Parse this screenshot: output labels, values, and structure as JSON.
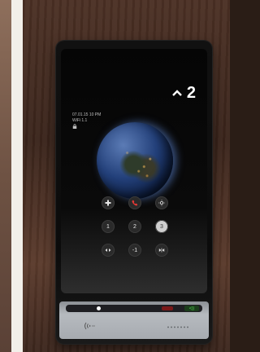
{
  "screen": {
    "floor": {
      "number": "2",
      "direction_icon": "chevron-up-icon"
    },
    "status": {
      "datetime": "07.01.15 10 PM",
      "info": "WiFi 1.1",
      "lock_icon": "lock-icon"
    },
    "globe_icon": "earth-globe-icon"
  },
  "controls": {
    "row1": [
      {
        "icon": "cross-icon"
      },
      {
        "icon": "phone-icon",
        "color": "#e53935"
      },
      {
        "icon": "sun-icon"
      }
    ],
    "row2": [
      {
        "label": "1"
      },
      {
        "label": "2"
      },
      {
        "label": "3",
        "state": "active"
      }
    ],
    "row3": [
      {
        "icon": "door-open-icon"
      },
      {
        "label": "-1"
      },
      {
        "icon": "door-close-icon"
      }
    ]
  },
  "panel": {
    "answer_label": "<))",
    "nfc_icon": "nfc-icon"
  }
}
